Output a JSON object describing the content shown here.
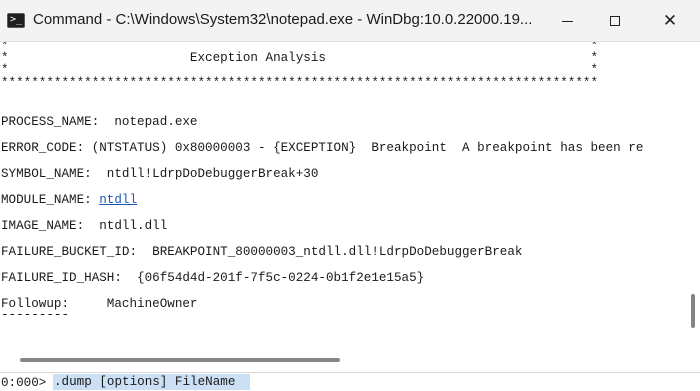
{
  "window": {
    "title": "Command - C:\\Windows\\System32\\notepad.exe - WinDbg:10.0.22000.19...",
    "app_icon": "terminal-icon",
    "app_icon_glyph": ">_",
    "minimize_glyph": "minimize-icon",
    "maximize_glyph": "maximize-icon",
    "close_glyph": "✕"
  },
  "output": {
    "lines": [
      "*                                                                             *",
      "*                        Exception Analysis                                   *",
      "*                                                                             *",
      "*******************************************************************************",
      "",
      "PROCESS_NAME:  notepad.exe",
      "",
      "ERROR_CODE: (NTSTATUS) 0x80000003 - {EXCEPTION}  Breakpoint  A breakpoint has been re",
      "",
      "SYMBOL_NAME:  ntdll!LdrpDoDebuggerBreak+30",
      "",
      "MODULE_NAME: ",
      "",
      "IMAGE_NAME:  ntdll.dll",
      "",
      "FAILURE_BUCKET_ID:  BREAKPOINT_80000003_ntdll.dll!LdrpDoDebuggerBreak",
      "",
      "FAILURE_ID_HASH:  {06f54d4d-201f-7f5c-0224-0b1f2e1e15a5}",
      "",
      "Followup:     MachineOwner",
      "---------"
    ],
    "module_link": "ntdll"
  },
  "command": {
    "prompt": "0:000> ",
    "value": ".dump [options] FileName"
  },
  "colors": {
    "link": "#1a55b8",
    "input_highlight": "#cce0f5",
    "titlebar": "#f3f3f3"
  }
}
